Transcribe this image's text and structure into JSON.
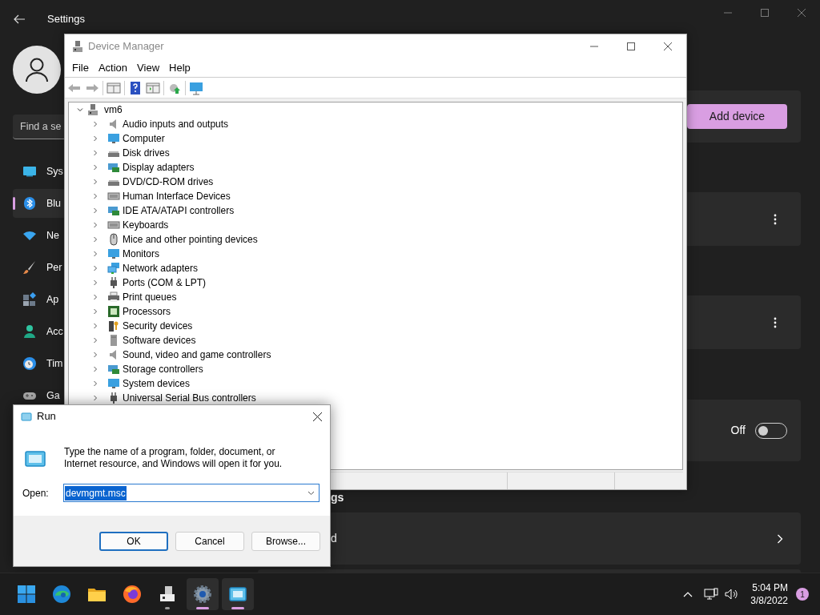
{
  "settings": {
    "title": "Settings",
    "search": {
      "placeholder": "Find a se"
    },
    "nav": [
      {
        "label": "Sys",
        "kind": "system",
        "selected": false
      },
      {
        "label": "Blu",
        "kind": "bluetooth",
        "selected": true
      },
      {
        "label": "Ne",
        "kind": "wifi",
        "selected": false
      },
      {
        "label": "Per",
        "kind": "brush",
        "selected": false
      },
      {
        "label": "Ap",
        "kind": "apps",
        "selected": false
      },
      {
        "label": "Acc",
        "kind": "person",
        "selected": false
      },
      {
        "label": "Tim",
        "kind": "clock",
        "selected": false
      },
      {
        "label": "Ga",
        "kind": "gamepad",
        "selected": false
      }
    ],
    "cards": [
      {
        "kind": "button",
        "label": "Add device"
      },
      {
        "kind": "menu"
      },
      {
        "kind": "menu"
      },
      {
        "kind": "toggle",
        "state_label": "Off",
        "on": false
      },
      {
        "kind": "heading",
        "label": "gs"
      },
      {
        "kind": "link",
        "label": "d"
      },
      {
        "kind": "empty"
      }
    ]
  },
  "device_manager": {
    "title": "Device Manager",
    "menu": [
      "File",
      "Action",
      "View",
      "Help"
    ],
    "tree": {
      "label": "vm6",
      "kind": "computer",
      "expanded": true,
      "children": [
        {
          "label": "Audio inputs and outputs",
          "kind": "speaker",
          "expanded": false
        },
        {
          "label": "Computer",
          "kind": "monitor",
          "expanded": false
        },
        {
          "label": "Disk drives",
          "kind": "drive",
          "expanded": false
        },
        {
          "label": "Display adapters",
          "kind": "card",
          "expanded": false
        },
        {
          "label": "DVD/CD-ROM drives",
          "kind": "drive",
          "expanded": false
        },
        {
          "label": "Human Interface Devices",
          "kind": "keyboard",
          "expanded": false
        },
        {
          "label": "IDE ATA/ATAPI controllers",
          "kind": "card",
          "expanded": false
        },
        {
          "label": "Keyboards",
          "kind": "keyboard",
          "expanded": false
        },
        {
          "label": "Mice and other pointing devices",
          "kind": "mouse",
          "expanded": false
        },
        {
          "label": "Monitors",
          "kind": "monitor",
          "expanded": false
        },
        {
          "label": "Network adapters",
          "kind": "network",
          "expanded": false
        },
        {
          "label": "Ports (COM & LPT)",
          "kind": "plug",
          "expanded": false
        },
        {
          "label": "Print queues",
          "kind": "printer",
          "expanded": false
        },
        {
          "label": "Processors",
          "kind": "chip",
          "expanded": false
        },
        {
          "label": "Security devices",
          "kind": "key",
          "expanded": false
        },
        {
          "label": "Software devices",
          "kind": "tower",
          "expanded": false
        },
        {
          "label": "Sound, video and game controllers",
          "kind": "speaker",
          "expanded": false
        },
        {
          "label": "Storage controllers",
          "kind": "card",
          "expanded": false
        },
        {
          "label": "System devices",
          "kind": "monitor",
          "expanded": false
        },
        {
          "label": "Universal Serial Bus controllers",
          "kind": "plug",
          "expanded": false
        }
      ]
    }
  },
  "run_dialog": {
    "title": "Run",
    "description": "Type the name of a program, folder, document, or Internet resource, and Windows will open it for you.",
    "open_label": "Open:",
    "value": "devmgmt.msc",
    "buttons": [
      {
        "label": "OK",
        "default": true
      },
      {
        "label": "Cancel",
        "default": false
      },
      {
        "label": "Browse...",
        "default": false
      }
    ]
  },
  "taskbar": {
    "apps": [
      {
        "kind": "start",
        "running": false,
        "focused": false
      },
      {
        "kind": "edge",
        "running": false,
        "focused": false
      },
      {
        "kind": "explorer",
        "running": false,
        "focused": false
      },
      {
        "kind": "firefox",
        "running": false,
        "focused": false
      },
      {
        "kind": "devices",
        "running": true,
        "focused": false
      },
      {
        "kind": "settings",
        "running": true,
        "focused": true
      },
      {
        "kind": "run",
        "running": true,
        "focused": true
      }
    ],
    "time": "5:04 PM",
    "date": "3/8/2022",
    "notification_count": "1"
  }
}
